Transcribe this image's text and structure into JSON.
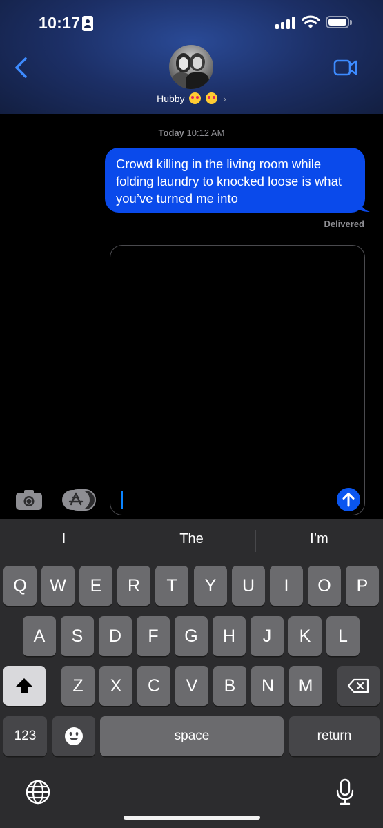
{
  "status_bar": {
    "time": "10:17"
  },
  "header": {
    "contact_name": "Hubby",
    "contact_emojis": [
      "heart-eyes",
      "kiss"
    ]
  },
  "conversation": {
    "timestamp_day": "Today",
    "timestamp_time": "10:12 AM",
    "messages": [
      {
        "direction": "outgoing",
        "text": "Crowd killing in the living room while folding laundry to knocked loose is what you’ve turned me into"
      }
    ],
    "delivery_status": "Delivered"
  },
  "compose": {
    "value": ""
  },
  "keyboard": {
    "suggestions": [
      "I",
      "The",
      "I’m"
    ],
    "row1": [
      "Q",
      "W",
      "E",
      "R",
      "T",
      "Y",
      "U",
      "I",
      "O",
      "P"
    ],
    "row2": [
      "A",
      "S",
      "D",
      "F",
      "G",
      "H",
      "J",
      "K",
      "L"
    ],
    "row3": [
      "Z",
      "X",
      "C",
      "V",
      "B",
      "N",
      "M"
    ],
    "numbers_label": "123",
    "space_label": "space",
    "return_label": "return"
  },
  "colors": {
    "accent": "#0a84ff",
    "bubble": "#0a4aeb",
    "keyboard_bg": "#2c2c2e",
    "key": "#6b6b6e"
  }
}
